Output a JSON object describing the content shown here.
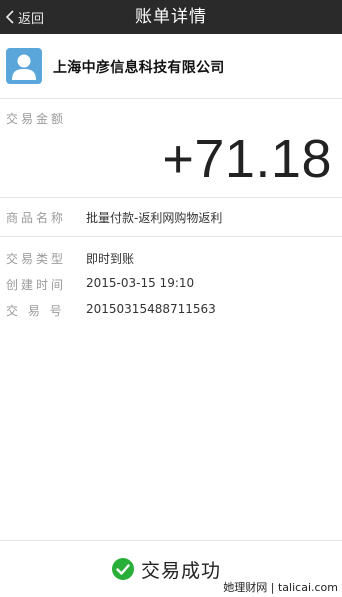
{
  "nav": {
    "back_label": "返回",
    "title": "账单详情"
  },
  "merchant": {
    "name": "上海中彦信息科技有限公司",
    "avatar_icon": "person-icon",
    "avatar_color": "#5aa6da"
  },
  "amount": {
    "label": "交易金额",
    "value": "+71.18"
  },
  "product": {
    "label": "商品名称",
    "value": "批量付款-返利网购物返利"
  },
  "details": [
    {
      "label": "交易类型",
      "value": "即时到账"
    },
    {
      "label": "创建时间",
      "value": "2015-03-15 19:10"
    },
    {
      "label": "交 易 号",
      "value": "20150315488711563"
    }
  ],
  "footer": {
    "status_icon": "check-circle-icon",
    "status_color": "#2aae3a",
    "status_text": "交易成功"
  },
  "watermark": "她理财网 | talicai.com"
}
